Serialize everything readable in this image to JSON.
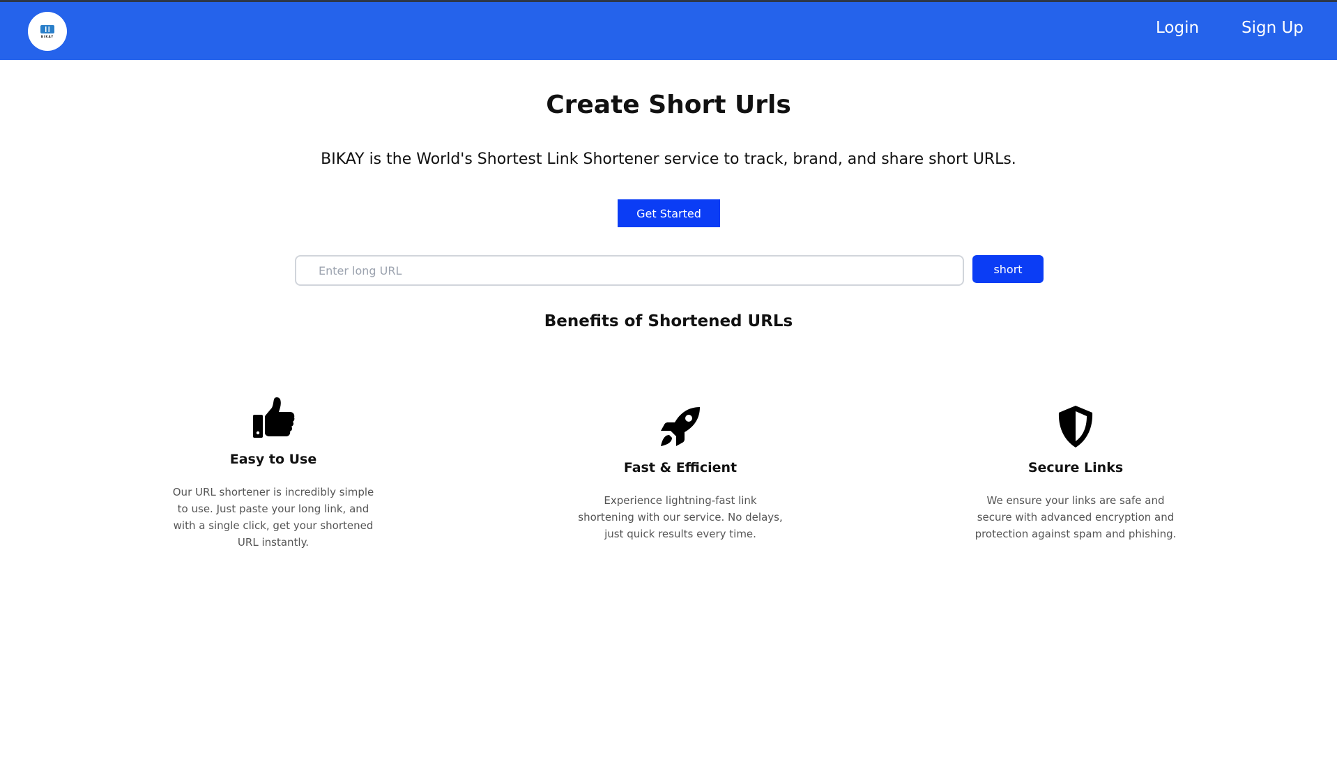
{
  "header": {
    "logo_text": "BIKAY",
    "login": "Login",
    "signup": "Sign Up"
  },
  "hero": {
    "title": "Create Short Urls",
    "subtitle": "BIKAY is the World's Shortest Link Shortener service to track, brand, and share short URLs.",
    "cta": "Get Started"
  },
  "shortener": {
    "placeholder": "Enter long URL",
    "button": "short"
  },
  "benefits": {
    "title": "Benefits of Shortened URLs",
    "items": [
      {
        "icon": "thumbs-up-icon",
        "title": "Easy to Use",
        "text": "Our URL shortener is incredibly simple to use. Just paste your long link, and with a single click, get your shortened URL instantly."
      },
      {
        "icon": "rocket-icon",
        "title": "Fast & Efficient",
        "text": "Experience lightning-fast link shortening with our service. No delays, just quick results every time."
      },
      {
        "icon": "shield-icon",
        "title": "Secure Links",
        "text": "We ensure your links are safe and secure with advanced encryption and protection against spam and phishing."
      }
    ]
  },
  "colors": {
    "navbar": "#2563eb",
    "button": "#0b3df5"
  }
}
